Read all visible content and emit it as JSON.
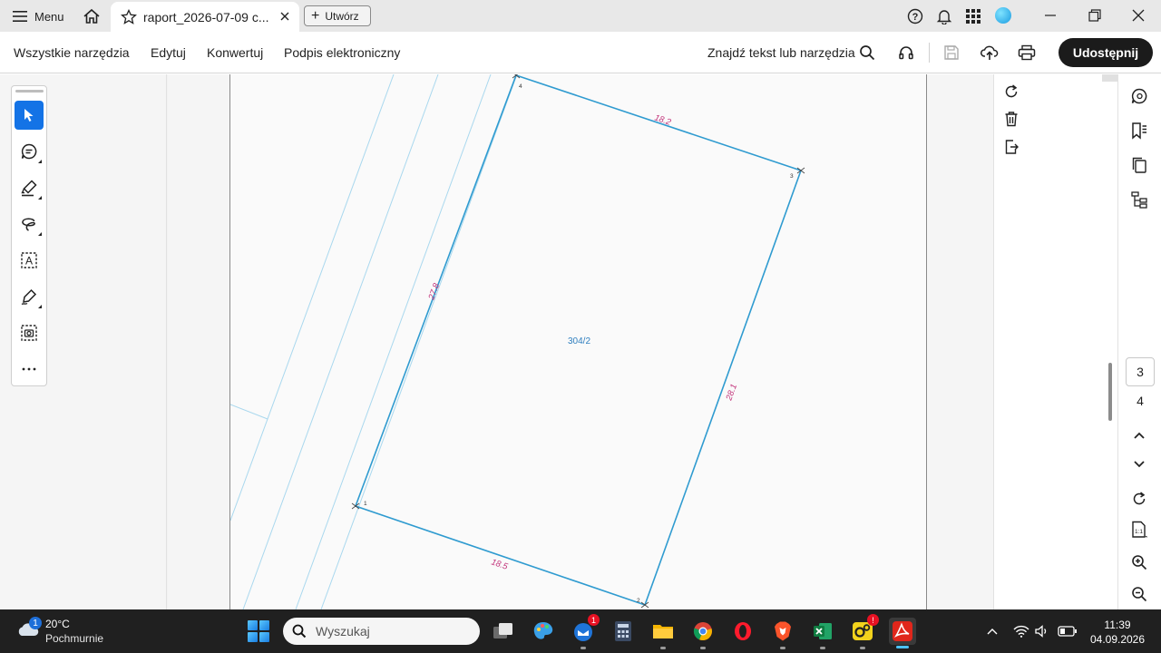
{
  "titlebar": {
    "menu_label": "Menu",
    "tab_title": "raport_2026-07-09 c...",
    "create_label": "Utwórz"
  },
  "menubar": {
    "items": [
      "Wszystkie narzędzia",
      "Edytuj",
      "Konwertuj",
      "Podpis elektroniczny"
    ],
    "find_label": "Znajdź tekst lub narzędzia",
    "share_label": "Udostępnij"
  },
  "document": {
    "parcel_label": "304/2",
    "edges": {
      "top": "18.2",
      "left": "27.8",
      "right": "28.1",
      "bottom": "18.5"
    },
    "vertices": {
      "v1": "1",
      "v2": "2",
      "v3": "3",
      "v4": "4"
    },
    "colors": {
      "boundary": "#2f9bd0",
      "edge_label": "#c2337a",
      "parcel_label": "#2f7fbf",
      "thin_lines": "#a9d8ee"
    }
  },
  "navigation": {
    "current_page": "3",
    "total_pages": "4"
  },
  "taskbar": {
    "weather_badge": "1",
    "temperature": "20°C",
    "condition": "Pochmurnie",
    "search_placeholder": "Wyszukaj",
    "mail_badge": "1",
    "app_badge": "!",
    "time": "11:39",
    "date": "04.09.2026"
  }
}
